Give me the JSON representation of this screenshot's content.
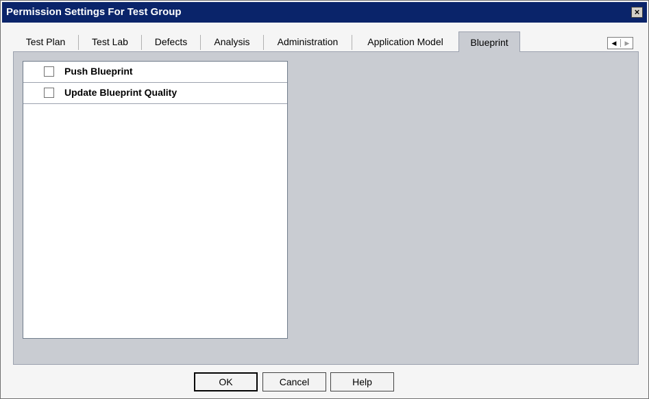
{
  "window": {
    "title": "Permission Settings For Test Group",
    "close_glyph": "×"
  },
  "tabs": [
    {
      "label": "Test Plan"
    },
    {
      "label": "Test Lab"
    },
    {
      "label": "Defects"
    },
    {
      "label": "Analysis"
    },
    {
      "label": "Administration"
    },
    {
      "label": "Application Model"
    },
    {
      "label": "Blueprint",
      "active": true
    }
  ],
  "tab_scroll": {
    "left_glyph": "◀",
    "right_glyph": "▶"
  },
  "permissions": [
    {
      "label": "Push Blueprint",
      "checked": false
    },
    {
      "label": "Update Blueprint Quality",
      "checked": false
    }
  ],
  "buttons": {
    "ok": "OK",
    "cancel": "Cancel",
    "help": "Help"
  },
  "colors": {
    "titlebar": "#0a246a",
    "panel": "#c9ccd2"
  }
}
